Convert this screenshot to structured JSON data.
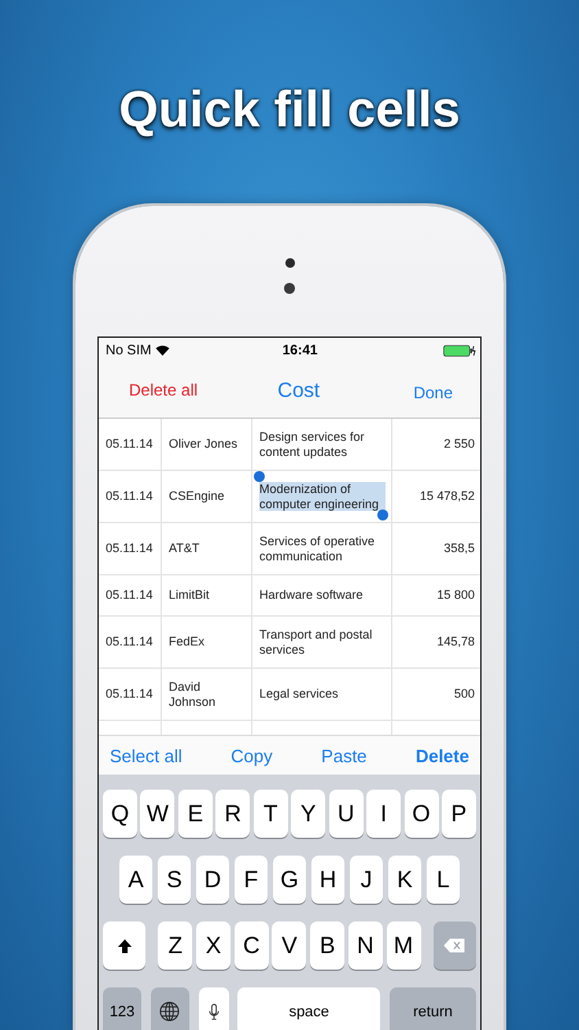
{
  "headline": "Quick fill cells",
  "status_bar": {
    "carrier": "No SIM",
    "time": "16:41"
  },
  "nav": {
    "left": "Delete all",
    "title": "Cost",
    "right": "Done"
  },
  "rows": [
    {
      "date": "05.11.14",
      "name": "Oliver Jones",
      "description": "Design services for content updates",
      "cost": "2 550",
      "text_selected": false
    },
    {
      "date": "05.11.14",
      "name": "CSEngine",
      "description": "Modernization of computer engineering",
      "cost": "15 478,52",
      "text_selected": true
    },
    {
      "date": "05.11.14",
      "name": "AT&T",
      "description": "Services of operative communication",
      "cost": "358,5",
      "text_selected": false
    },
    {
      "date": "05.11.14",
      "name": "LimitBit",
      "description": "Hardware software",
      "cost": "15 800",
      "text_selected": false
    },
    {
      "date": "05.11.14",
      "name": "FedEx",
      "description": "Transport and postal services",
      "cost": "145,78",
      "text_selected": false
    },
    {
      "date": "05.11.14",
      "name": "David Johnson",
      "description": "Legal services",
      "cost": "500",
      "text_selected": false
    }
  ],
  "edit_menu": [
    {
      "label": "Select all",
      "emphasized": false
    },
    {
      "label": "Copy",
      "emphasized": false
    },
    {
      "label": "Paste",
      "emphasized": false
    },
    {
      "label": "Delete",
      "emphasized": true
    }
  ],
  "keyboard": {
    "rows": [
      [
        "Q",
        "W",
        "E",
        "R",
        "T",
        "Y",
        "U",
        "I",
        "O",
        "P"
      ],
      [
        "A",
        "S",
        "D",
        "F",
        "G",
        "H",
        "J",
        "K",
        "L"
      ],
      [
        "Z",
        "X",
        "C",
        "V",
        "B",
        "N",
        "M"
      ]
    ],
    "numbers_key": "123",
    "space_key": "space",
    "return_key": "return"
  }
}
